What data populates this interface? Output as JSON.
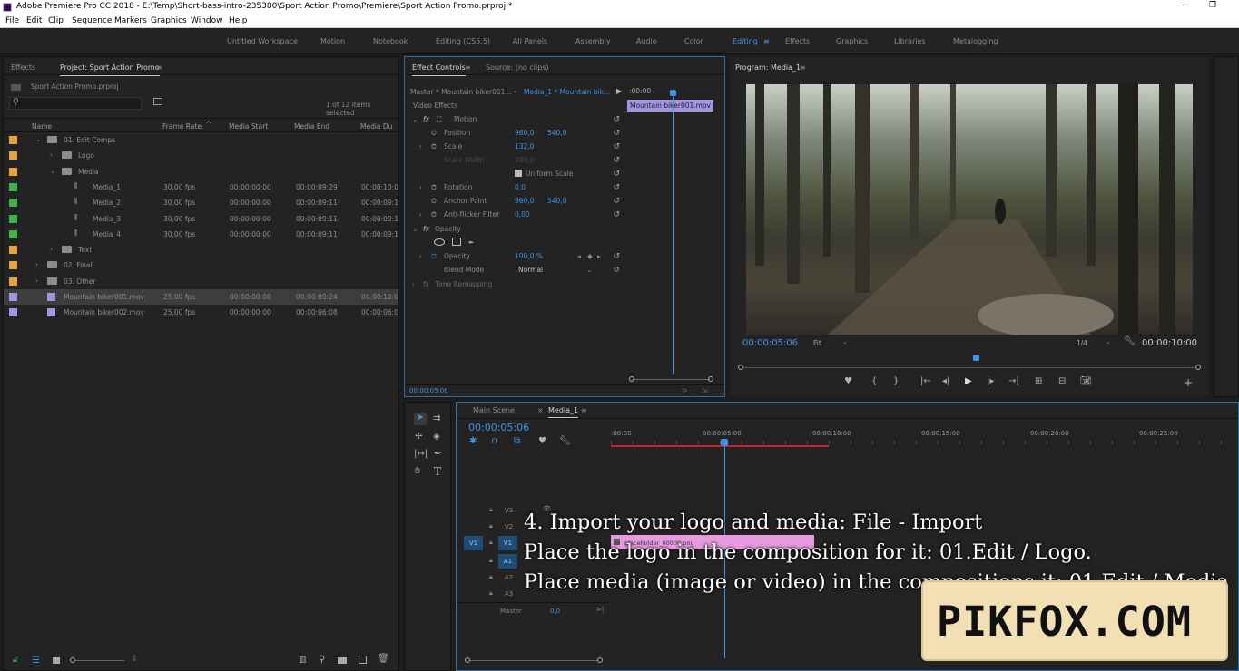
{
  "window": {
    "title": "Adobe Premiere Pro CC 2018 - E:\\Temp\\Short-bass-intro-235380\\Sport Action Promo\\Premiere\\Sport Action Promo.prproj *"
  },
  "menu": [
    "File",
    "Edit",
    "Clip",
    "Sequence",
    "Markers",
    "Graphics",
    "Window",
    "Help"
  ],
  "workspaces": [
    "Untitled Workspace",
    "Motion",
    "Notebook",
    "Editing (CS5.5)",
    "All Panels",
    "Assembly",
    "Audio",
    "Color",
    "Editing",
    "Effects",
    "Graphics",
    "Libraries",
    "Metalogging"
  ],
  "project": {
    "tab_effects": "Effects",
    "tab_project": "Project: Sport Action Promo",
    "file": "Sport Action Promo.prproj",
    "items_selected": "1 of 12 items selected",
    "columns": [
      "Name",
      "Frame Rate",
      "Media Start",
      "Media End",
      "Media Du"
    ],
    "rows": [
      {
        "name": "01. Edit Comps",
        "type": "folder",
        "rate": "",
        "start": "",
        "end": "",
        "dur": "",
        "color": "#e8a23b"
      },
      {
        "name": "Logo",
        "type": "folder",
        "rate": "",
        "start": "",
        "end": "",
        "dur": "",
        "color": "#e8a23b"
      },
      {
        "name": "Media",
        "type": "folder",
        "rate": "",
        "start": "",
        "end": "",
        "dur": "",
        "color": "#e8a23b"
      },
      {
        "name": "Media_1",
        "type": "seq",
        "rate": "30,00 fps",
        "start": "00:00:00:00",
        "end": "00:00:09:29",
        "dur": "00:00:10:0",
        "color": "#3fb24a"
      },
      {
        "name": "Media_2",
        "type": "seq",
        "rate": "30,00 fps",
        "start": "00:00:00:00",
        "end": "00:00:09:11",
        "dur": "00:00:09:1",
        "color": "#3fb24a"
      },
      {
        "name": "Media_3",
        "type": "seq",
        "rate": "30,00 fps",
        "start": "00:00:00:00",
        "end": "00:00:09:11",
        "dur": "00:00:09:1",
        "color": "#3fb24a"
      },
      {
        "name": "Media_4",
        "type": "seq",
        "rate": "30,00 fps",
        "start": "00:00:00:00",
        "end": "00:00:09:11",
        "dur": "00:00:09:1",
        "color": "#3fb24a"
      },
      {
        "name": "Text",
        "type": "folder",
        "rate": "",
        "start": "",
        "end": "",
        "dur": "",
        "color": "#e8a23b"
      },
      {
        "name": "02. Final",
        "type": "folder",
        "rate": "",
        "start": "",
        "end": "",
        "dur": "",
        "color": "#e8a23b"
      },
      {
        "name": "03. Other",
        "type": "folder",
        "rate": "",
        "start": "",
        "end": "",
        "dur": "",
        "color": "#e8a23b"
      },
      {
        "name": "Mountain biker001.mov",
        "type": "clip",
        "rate": "25,00 fps",
        "start": "00:00:00:00",
        "end": "00:00:09:24",
        "dur": "00:00:10:0",
        "color": "#a495e2"
      },
      {
        "name": "Mountain biker002.mov",
        "type": "clip",
        "rate": "25,00 fps",
        "start": "00:00:00:00",
        "end": "00:00:06:08",
        "dur": "00:00:06:0",
        "color": "#a495e2"
      }
    ]
  },
  "effect_controls": {
    "tab": "Effect Controls",
    "source_tab": "Source: (no clips)",
    "master": "Master * Mountain biker001...",
    "sequence": "Media_1 * Mountain bik...",
    "time_start": ":00:00",
    "clip_label": "Mountain biker001.mov",
    "video_effects": "Video Effects",
    "motion": "Motion",
    "position_label": "Position",
    "position_x": "960,0",
    "position_y": "540,0",
    "scale_label": "Scale",
    "scale": "132,0",
    "scale_width_label": "Scale Width",
    "scale_width": "100,0",
    "uniform_scale": "Uniform Scale",
    "rotation_label": "Rotation",
    "rotation": "0,0",
    "anchor_label": "Anchor Point",
    "anchor_x": "960,0",
    "anchor_y": "540,0",
    "antiflicker_label": "Anti-flicker Filter",
    "antiflicker": "0,00",
    "opacity_section": "Opacity",
    "opacity_label": "Opacity",
    "opacity": "100,0 %",
    "blend_label": "Blend Mode",
    "blend": "Normal",
    "time_remap": "Time Remapping",
    "timecode": "00:00:05:06"
  },
  "program": {
    "tab": "Program: Media_1",
    "timecode": "00:00:05:06",
    "fit": "Fit",
    "res": "1/4",
    "duration": "00:00:10:00"
  },
  "timeline": {
    "tab_main": "Main Scene",
    "tab_media": "Media_1",
    "timecode": "00:00:05:06",
    "ruler": [
      ":00:00",
      "00:00:05:00",
      "00:00:10:00",
      "00:00:15:00",
      "00:00:20:00",
      "00:00:25:00"
    ],
    "tracks": [
      "V3",
      "V2",
      "V1",
      "A1",
      "A2",
      "A3"
    ],
    "master_label": "Master",
    "master_value": "0,0",
    "clip_label": "placeholder_00000.png",
    "v1_source": "V1"
  },
  "overlay": {
    "line1": "4. Import your logo and media: File - Import",
    "line2": "Place the logo in the composition for it: 01.Edit / Logo.",
    "line3": "Place media (image or video) in the compositions it: 01.Edit / Media"
  },
  "watermark": {
    "text": "PIKFOX.COM"
  }
}
